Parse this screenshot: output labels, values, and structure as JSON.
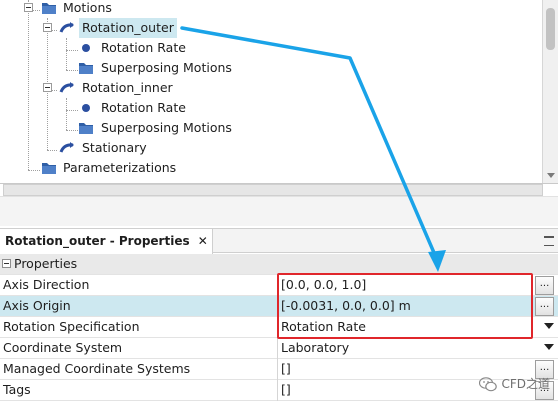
{
  "tree": {
    "items": [
      {
        "label": "Motions",
        "icon": "folder-icon"
      },
      {
        "label": "Rotation_outer",
        "icon": "rotation-motion-icon",
        "selected": true
      },
      {
        "label": "Rotation Rate",
        "icon": "bullet-icon"
      },
      {
        "label": "Superposing Motions",
        "icon": "folder-icon"
      },
      {
        "label": "Rotation_inner",
        "icon": "rotation-motion-icon"
      },
      {
        "label": "Rotation Rate",
        "icon": "bullet-icon"
      },
      {
        "label": "Superposing Motions",
        "icon": "folder-icon"
      },
      {
        "label": "Stationary",
        "icon": "stationary-motion-icon"
      },
      {
        "label": "Parameterizations",
        "icon": "folder-icon"
      }
    ]
  },
  "properties": {
    "tab_title": "Rotation_outer - Properties",
    "tab_close": "✕",
    "group_label": "Properties",
    "rows": [
      {
        "name": "Axis Direction",
        "value": "[0.0, 0.0, 1.0]",
        "editor": "ellipsis"
      },
      {
        "name": "Axis Origin",
        "value": "[-0.0031, 0.0, 0.0] m",
        "editor": "ellipsis"
      },
      {
        "name": "Rotation Specification",
        "value": "Rotation Rate",
        "editor": "dropdown"
      },
      {
        "name": "Coordinate System",
        "value": "Laboratory",
        "editor": "dropdown"
      },
      {
        "name": "Managed Coordinate Systems",
        "value": "[]",
        "editor": "ellipsis"
      },
      {
        "name": "Tags",
        "value": "[]",
        "editor": "ellipsis"
      }
    ],
    "ellipsis_label": "..."
  },
  "annotation": {
    "box_color": "#e0262b",
    "arrow_color": "#1aa3e8"
  },
  "watermark": {
    "text": "CFD之道"
  },
  "colors": {
    "selection": "#cde8f0",
    "folder": "#2f5fa6",
    "motion_icon": "#2b4fa0"
  }
}
